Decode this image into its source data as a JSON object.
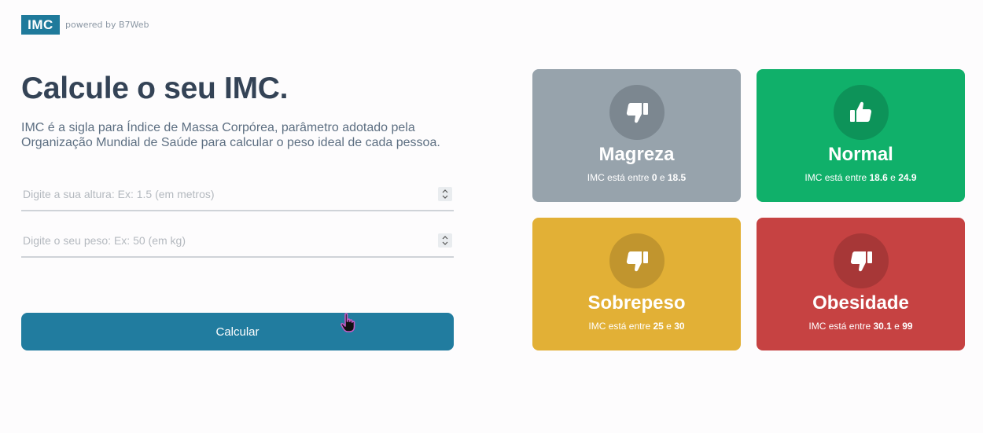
{
  "header": {
    "logo": "IMC",
    "powered": "powered by B7Web"
  },
  "main": {
    "title": "Calcule o seu IMC.",
    "description": "IMC é a sigla para Índice de Massa Corpórea, parâmetro adotado pela Organização Mundial de Saúde para calcular o peso ideal de cada pessoa.",
    "height_placeholder": "Digite a sua altura: Ex: 1.5 (em metros)",
    "weight_placeholder": "Digite o seu peso: Ex: 50 (em kg)",
    "calculate_label": "Calcular"
  },
  "cards": [
    {
      "name": "Magreza",
      "prefix": "IMC está entre",
      "min": "0",
      "sep": "e",
      "max": "18.5",
      "color": "#97a3ac",
      "circle": "#7c8790",
      "icon": "thumbs-down-icon"
    },
    {
      "name": "Normal",
      "prefix": "IMC está entre",
      "min": "18.6",
      "sep": "e",
      "max": "24.9",
      "color": "#10b06a",
      "circle": "#0d9359",
      "icon": "thumbs-up-icon"
    },
    {
      "name": "Sobrepeso",
      "prefix": "IMC está entre",
      "min": "25",
      "sep": "e",
      "max": "30",
      "color": "#e2b036",
      "circle": "#c1952e",
      "icon": "thumbs-down-icon"
    },
    {
      "name": "Obesidade",
      "prefix": "IMC está entre",
      "min": "30.1",
      "sep": "e",
      "max": "99",
      "color": "#c64242",
      "circle": "#a73737",
      "icon": "thumbs-down-icon"
    }
  ]
}
